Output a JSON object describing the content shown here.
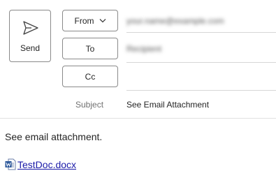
{
  "compose": {
    "send_label": "Send",
    "from_label": "From",
    "to_label": "To",
    "cc_label": "Cc",
    "from_value": "your.name@example.com",
    "to_value": "Recipient",
    "subject_label": "Subject",
    "subject_value": "See Email Attachment"
  },
  "message": {
    "body": "See email attachment.",
    "attachment_name": "TestDoc.docx",
    "attachment_icon": "word-document-icon"
  },
  "colors": {
    "border": "#8a8a8a",
    "link": "#1a1aa8",
    "word_blue": "#2b579a"
  }
}
